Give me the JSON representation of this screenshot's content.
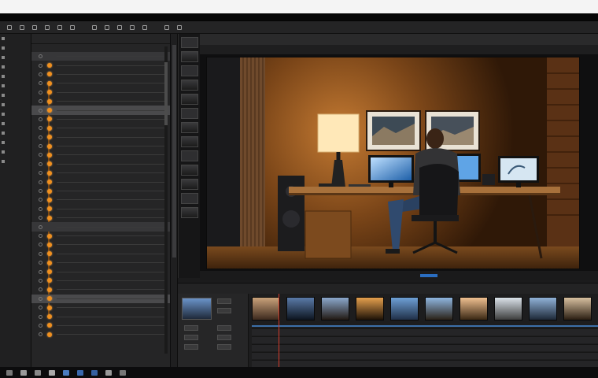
{
  "menubar": {
    "items": [
      ""
    ]
  },
  "accent_colors": {
    "layer_dot": "#f0901f",
    "timeline_track": "#3c6fa8",
    "playhead": "#d23b2b"
  }
}
